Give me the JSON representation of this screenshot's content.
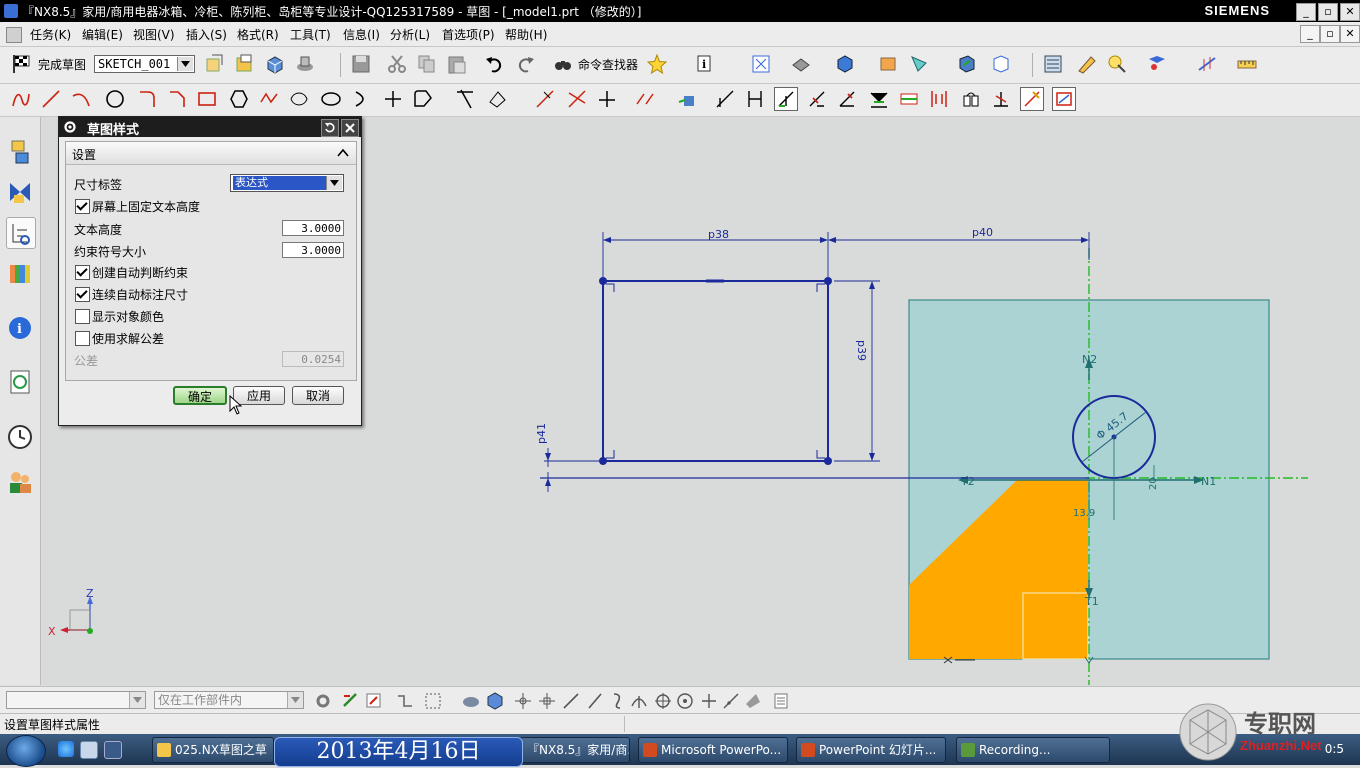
{
  "window": {
    "title": "『NX8.5』家用/商用电器冰箱、冷柜、陈列柜、岛柜等专业设计-QQ125317589 - 草图 - [_model1.prt （修改的）]",
    "brand": "SIEMENS",
    "controls": [
      "_",
      "▫",
      "✕"
    ]
  },
  "menu": {
    "items": [
      "任务(K)",
      "编辑(E)",
      "视图(V)",
      "插入(S)",
      "格式(R)",
      "工具(T)",
      "信息(I)",
      "分析(L)",
      "首选项(P)",
      "帮助(H)"
    ],
    "doc_controls": [
      "_",
      "▫",
      "✕"
    ]
  },
  "toolbar": {
    "finish_sketch_label": "完成草图",
    "sketch_name": "SKETCH_001",
    "command_finder_label": "命令查找器"
  },
  "dialog": {
    "title": "草图样式",
    "section": "设置",
    "dim_label_label": "尺寸标签",
    "dim_label_value": "表达式",
    "fixed_text_height_label": "屏幕上固定文本高度",
    "fixed_text_height_checked": true,
    "text_height_label": "文本高度",
    "text_height_value": "3.0000",
    "constraint_symbol_label": "约束符号大小",
    "constraint_symbol_value": "3.0000",
    "auto_infer_label": "创建自动判断约束",
    "auto_infer_checked": true,
    "continuous_dim_label": "连续自动标注尺寸",
    "continuous_dim_checked": true,
    "show_color_label": "显示对象颜色",
    "show_color_checked": false,
    "solver_tol_label": "使用求解公差",
    "solver_tol_checked": false,
    "tolerance_label": "公差",
    "tolerance_value": "0.0254",
    "ok_label": "确定",
    "apply_label": "应用",
    "cancel_label": "取消"
  },
  "sketch": {
    "dim_p38": "p38",
    "dim_p40": "p40",
    "dim_p39": "p39",
    "dim_p41": "p41",
    "circle_dim": "Φ 45.7",
    "dim_13_9": "13.9",
    "dim_20": "20",
    "axis_n2": "N2",
    "axis_t2": "T2",
    "axis_n1": "N1",
    "axis_t1": "T1",
    "triad_z": "Z",
    "triad_x": "X",
    "face_color": "#acd3d3",
    "orange_color": "#ffa800",
    "sketch_color": "#1a2a9a"
  },
  "bottom": {
    "filter_placeholder": "",
    "scope_value": "仅在工作部件内"
  },
  "status": {
    "text": "设置草图样式属性"
  },
  "taskbar": {
    "date": "2013年4月16日",
    "tasks": [
      "025.NX草图之草",
      "『NX8.5』家用/商...",
      "Microsoft PowerPo...",
      "PowerPoint 幻灯片...",
      "Recording..."
    ],
    "time": "0:5"
  },
  "watermark": {
    "cn": "专职网",
    "url": "Zhuanzhi.Net"
  }
}
